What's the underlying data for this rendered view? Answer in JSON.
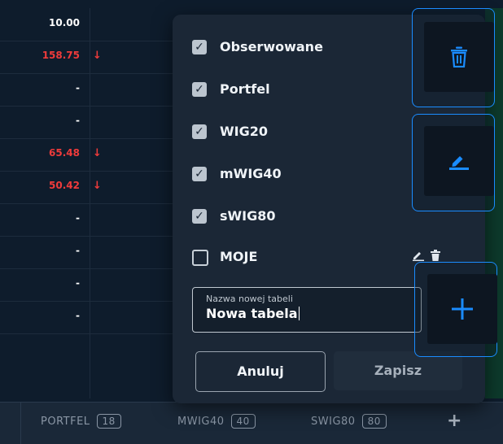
{
  "table": {
    "rows": [
      {
        "value": "10.00",
        "color": "#ffffff",
        "down": false
      },
      {
        "value": "158.75",
        "color": "#ef3b3b",
        "down": true
      },
      {
        "value": "-",
        "color": "#ffffff",
        "down": false
      },
      {
        "value": "-",
        "color": "#ffffff",
        "down": false
      },
      {
        "value": "65.48",
        "color": "#ef3b3b",
        "down": true
      },
      {
        "value": "50.42",
        "color": "#ef3b3b",
        "down": true
      },
      {
        "value": "-",
        "color": "#ffffff",
        "down": false
      },
      {
        "value": "-",
        "color": "#ffffff",
        "down": false
      },
      {
        "value": "-",
        "color": "#ffffff",
        "down": false
      },
      {
        "value": "-",
        "color": "#ffffff",
        "down": false
      }
    ],
    "down_arrow": "↓"
  },
  "tabs": [
    {
      "label": "PORTFEL",
      "count": "18"
    },
    {
      "label": "MWIG40",
      "count": "40"
    },
    {
      "label": "SWIG80",
      "count": "80"
    }
  ],
  "add_tab_symbol": "+",
  "panel": {
    "options": [
      {
        "label": "Obserwowane",
        "checked": true
      },
      {
        "label": "Portfel",
        "checked": true
      },
      {
        "label": "WIG20",
        "checked": true
      },
      {
        "label": "mWIG40",
        "checked": true
      },
      {
        "label": "sWIG80",
        "checked": true
      },
      {
        "label": "MOJE",
        "checked": false
      }
    ],
    "check_glyph": "✓",
    "new_table": {
      "label": "Nazwa nowej tabeli",
      "value": "Nowa tabela"
    },
    "cancel_label": "Anuluj",
    "save_label": "Zapisz"
  },
  "actions": {
    "accent": "#1a8cff",
    "icons": [
      "trash-icon",
      "edit-icon",
      "plus-icon"
    ]
  }
}
